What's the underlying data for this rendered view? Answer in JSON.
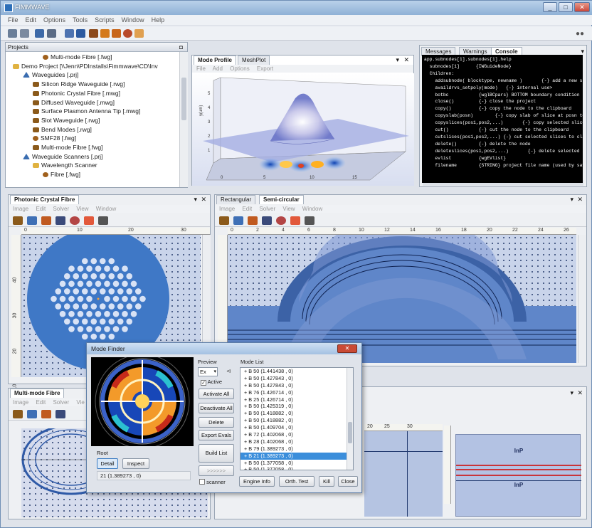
{
  "app": {
    "title": "FIMMWAVE"
  },
  "window_buttons": {
    "minimize": "_",
    "maximize": "□",
    "close": "✕"
  },
  "menu": [
    "File",
    "Edit",
    "Options",
    "Tools",
    "Scripts",
    "Window",
    "Help"
  ],
  "projects": {
    "header": "Projects",
    "pin": "◘",
    "items": [
      {
        "label": "Multi-mode Fibre [.fwg]",
        "icon": "ball",
        "depth": 4
      },
      {
        "label": "Demo Project [\\\\Jenn\\PDInstalls\\Fimmwave\\CD\\Inv",
        "icon": "project",
        "depth": 1
      },
      {
        "label": "Waveguides [.prj]",
        "icon": "tri",
        "depth": 2
      },
      {
        "label": "Silicon Ridge Waveguide [.rwg]",
        "icon": "wg",
        "depth": 3
      },
      {
        "label": "Photonic Crystal Fibre [.mwg]",
        "icon": "wg",
        "depth": 3
      },
      {
        "label": "Diffused Waveguide [.mwg]",
        "icon": "wg",
        "depth": 3
      },
      {
        "label": "Surface Plasmon Antenna Tip [.mwg]",
        "icon": "wg",
        "depth": 3
      },
      {
        "label": "Slot Waveguide [.rwg]",
        "icon": "wg",
        "depth": 3
      },
      {
        "label": "Bend Modes [.rwg]",
        "icon": "wg",
        "depth": 3
      },
      {
        "label": "SMF28 [.fwg]",
        "icon": "ball",
        "depth": 3
      },
      {
        "label": "Multi-mode Fibre [.fwg]",
        "icon": "wg",
        "depth": 3
      },
      {
        "label": "Waveguide Scanners [.prj]",
        "icon": "tri",
        "depth": 2
      },
      {
        "label": "Wavelength Scanner",
        "icon": "fold",
        "depth": 3
      },
      {
        "label": "Fibre [.fwg]",
        "icon": "ball",
        "depth": 4
      }
    ]
  },
  "mode_profile": {
    "tabs": [
      "Mode Profile",
      "MeshPlot"
    ],
    "menu": "File Add Options Export",
    "ylabel": "y(um)",
    "xticks": [
      "0",
      "5",
      "10",
      "15"
    ],
    "yticks": [
      "5",
      "4",
      "3",
      "2",
      "1"
    ]
  },
  "console": {
    "tabs": [
      "Messages",
      "Warnings",
      "Console"
    ],
    "lines": [
      "app.subnodes[1].subnodes[1].help",
      "  subnodes[1]      {IWGuideNode}",
      "  Children:",
      "    addsubnode( blocktype, newname )       {-} add a new s",
      "    availdrvs_setpoly(mode)   {-} internal use>",
      "    botbc           {wglBCpars} BOTTOM boundary condition",
      "    close()         {-} close the project",
      "    copy()          {-} copy the node to the clipboard",
      "    copyslab(posn)        {-} copy slab of slice at posn to clip",
      "    copyslices(pos1,pos2,...)       {-} copy selected slices to",
      "    cut()           {-} cut the node to the clipboard",
      "    cutslices(pos1,pos2,...) {-} cut selected slices to clipboard",
      "    delete()        {-} delete the node",
      "    deleteslices(pos1,pos2,...)       {-} delete selected slices",
      "    evlist          {wgEVlist}",
      "    filename        {STRING} project file name (used by save)"
    ]
  },
  "pcf": {
    "title": "Photonic Crystal Fibre",
    "menu": "Image Edit Solver View Window",
    "xticks": [
      "0",
      "10",
      "20",
      "30"
    ],
    "yticks": [
      "40",
      "30",
      "20",
      "10"
    ]
  },
  "rect": {
    "tabs": [
      "Rectangular",
      "Semi-circular"
    ],
    "menu": "Image Edit Solver View Window",
    "xticks": [
      "0",
      "2",
      "4",
      "6",
      "8",
      "10",
      "12",
      "14",
      "16",
      "18",
      "20",
      "22",
      "24",
      "26"
    ]
  },
  "mmf": {
    "title": "Multi-mode Fibre",
    "menu": "Image Edit Solver Vie"
  },
  "lower_right": {
    "xticks": [
      "20",
      "25",
      "30"
    ],
    "layer_top": "InP",
    "layer_bottom": "InP"
  },
  "mode_finder": {
    "title": "Mode Finder",
    "close": "✕",
    "preview_label": "Preview",
    "component": "Ex",
    "active_label": "Active",
    "mode_list_label": "Mode List",
    "buttons": {
      "activate_all": "Activate All",
      "deactivate_all": "Deactivate All",
      "delete": "Delete",
      "export_evals": "Export Evals",
      "build_list": "Build List",
      "arrows": ">>>>>>",
      "detail": "Detail",
      "inspect": "Inspect",
      "engine_info": "Engine Info",
      "orth_test": "Orth. Test",
      "kill": "Kill",
      "close": "Close"
    },
    "root_label": "Root",
    "root_value": "21 (1.389273 , 0)",
    "scanner_label": "scanner",
    "modes": [
      "+ B 50 (1.441438 , 0)",
      "+ B 50 (1.427843 , 0)",
      "+ B 50 (1.427843 , 0)",
      "+ B 76 (1.426714 , 0)",
      "+ B 25 (1.426714 , 0)",
      "+ B 50 (1.425319 , 0)",
      "+ B 50 (1.418882 , 0)",
      "+ B 50 (1.418882 , 0)",
      "+ B 50 (1.409704 , 0)",
      "+ B 72 (1.402068 , 0)",
      "+ B 28 (1.402068 , 0)",
      "+ B 79 (1.389273 , 0)",
      "+ B 21 (1.389273 , 0)",
      "+ B 50 (1.377058 , 0)",
      "+ B 50 (1.377058 , 0)"
    ],
    "selected_index": 12
  }
}
